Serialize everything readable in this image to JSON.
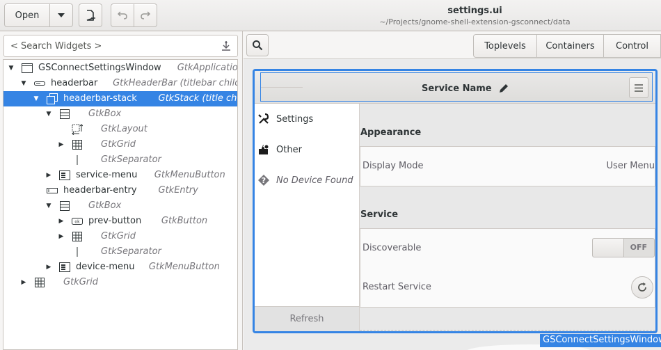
{
  "toolbar": {
    "open_label": "Open",
    "open_menu_icon": "pan-down-icon",
    "new_icon": "document-new-icon",
    "undo_icon": "undo-icon",
    "redo_icon": "redo-icon"
  },
  "window": {
    "title": "settings.ui",
    "subtitle": "~/Projects/gnome-shell-extension-gsconnect/data"
  },
  "widget_search": {
    "placeholder": "< Search Widgets >"
  },
  "tree": [
    {
      "name": "GSConnectSettingsWindow",
      "type": "GtkApplication…",
      "expander": "open",
      "icon": "window-icon"
    },
    {
      "name": "headerbar",
      "type": "GtkHeaderBar  (titlebar child)",
      "expander": "open",
      "icon": "headerbar-icon"
    },
    {
      "name": "headerbar-stack",
      "type": "GtkStack  (title child)",
      "expander": "open",
      "icon": "stack-icon",
      "selected": true
    },
    {
      "name": "",
      "type": "GtkBox",
      "expander": "open",
      "icon": "box-icon"
    },
    {
      "name": "",
      "type": "GtkLayout",
      "expander": "none",
      "icon": "layout-icon"
    },
    {
      "name": "",
      "type": "GtkGrid",
      "expander": "closed",
      "icon": "grid-icon"
    },
    {
      "name": "",
      "type": "GtkSeparator",
      "expander": "none",
      "icon": "separator-icon"
    },
    {
      "name": "service-menu",
      "type": "GtkMenuButton",
      "expander": "closed",
      "icon": "menubutton-icon"
    },
    {
      "name": "headerbar-entry",
      "type": "GtkEntry",
      "expander": "none",
      "icon": "entry-icon"
    },
    {
      "name": "",
      "type": "GtkBox",
      "expander": "open",
      "icon": "box-icon"
    },
    {
      "name": "prev-button",
      "type": "GtkButton",
      "expander": "closed",
      "icon": "button-icon"
    },
    {
      "name": "",
      "type": "GtkGrid",
      "expander": "closed",
      "icon": "grid-icon"
    },
    {
      "name": "",
      "type": "GtkSeparator",
      "expander": "none",
      "icon": "separator-icon"
    },
    {
      "name": "device-menu",
      "type": "GtkMenuButton",
      "expander": "closed",
      "icon": "menubutton-icon"
    },
    {
      "name": "",
      "type": "GtkGrid",
      "expander": "closed",
      "icon": "grid-icon"
    }
  ],
  "palette": {
    "tabs": [
      "Toplevels",
      "Containers",
      "Control"
    ]
  },
  "preview": {
    "header_title": "Service Name",
    "sidebar": [
      {
        "label": "Settings",
        "icon": "tools-icon",
        "muted": false
      },
      {
        "label": "Other",
        "icon": "extensions-icon",
        "muted": false
      },
      {
        "label": "No Device Found",
        "icon": "question-icon",
        "muted": true
      }
    ],
    "refresh_label": "Refresh",
    "appearance": {
      "title": "Appearance",
      "display_mode_label": "Display Mode",
      "display_mode_value": "User Menu"
    },
    "service": {
      "title": "Service",
      "discoverable_label": "Discoverable",
      "discoverable_state": "OFF",
      "restart_label": "Restart Service"
    },
    "window_name": "GSConnectSettingsWindow"
  },
  "colors": {
    "selection": "#3584e4",
    "headerbar": "#e8e7e6"
  }
}
